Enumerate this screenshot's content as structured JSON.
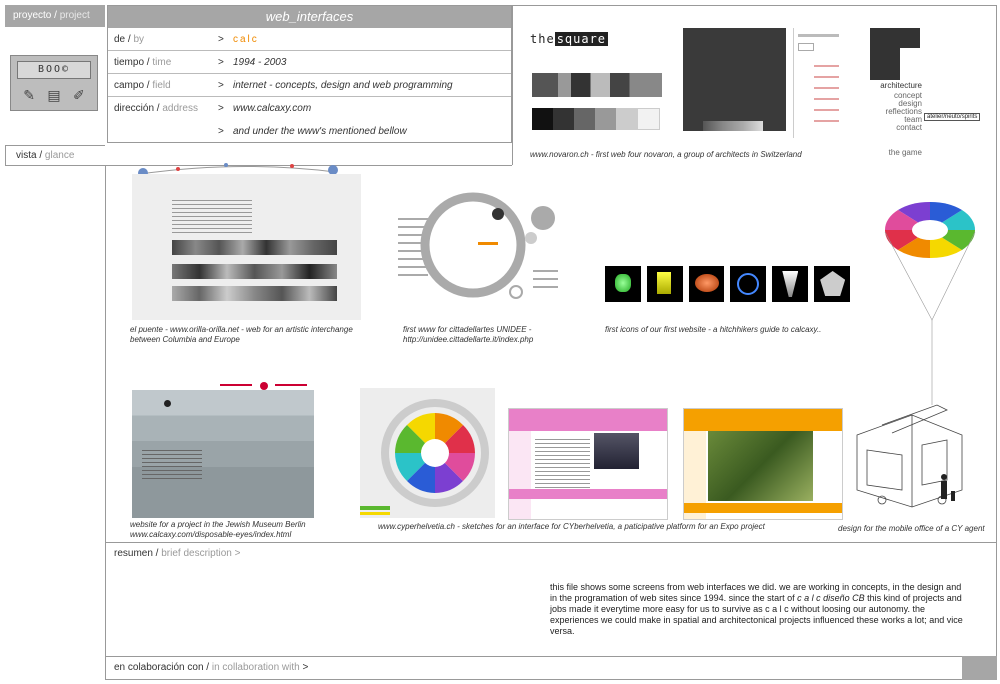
{
  "tab": {
    "es": "proyecto",
    "sep": "/",
    "en": "project"
  },
  "logo": {
    "text": "BOO©",
    "tools": [
      "✎",
      "▤",
      "✐"
    ]
  },
  "info": {
    "title": "web_interfaces",
    "rows": [
      {
        "es": "de",
        "en": "by",
        "arrow": ">",
        "value": "calc"
      },
      {
        "es": "tiempo",
        "en": "time",
        "arrow": ">",
        "value": "1994 - 2003"
      },
      {
        "es": "campo",
        "en": "field",
        "arrow": ">",
        "value": "internet - concepts, design and web programming"
      },
      {
        "es": "dirección",
        "en": "address",
        "arrow": ">",
        "value": "www.calcaxy.com"
      },
      {
        "es": "",
        "en": "",
        "arrow": ">",
        "value": "and under the www's mentioned bellow"
      }
    ]
  },
  "vista": {
    "es": "vista",
    "en": "glance"
  },
  "novaron": {
    "logo_prefix": "the",
    "logo_box": "square",
    "caption": "www.novaron.ch - first web four novaron, a group of architects in Switzerland"
  },
  "architecture": {
    "title": "architecture",
    "links": [
      "concept",
      "design",
      "reflections",
      "team",
      "contact"
    ],
    "tag": "atelier/neuto/spirits",
    "game": "the game"
  },
  "captions": {
    "puente": "el puente - www.orilla-orilla.net - web for an artistic interchange between Columbia and Europe",
    "unidee": "first www for cittadellartes UNIDEE - http://unidee.cittadellarte.it/index.php",
    "icons": "first icons of our first website - a hitchhikers guide to calcaxy..",
    "museum": "website for a project in the Jewish Museum Berlin www.calcaxy.com/disposable-eyes/index.html",
    "cyber": "www.cyperhelvetia.ch - sketches for an interface for CYberhelvetia, a paticipative platform for an Expo project",
    "mobile": "design for the mobile office of a CY agent"
  },
  "resumen": {
    "es": "resumen",
    "en": "brief description",
    "arrow": ">"
  },
  "summary": {
    "part1": "this file shows some screens from web interfaces we did. we are working in concepts, in the design and in the programation of web sites since 1994. since the start of ",
    "emph": "c a l c diseño CB",
    "part2": " this kind of projects and jobs made it everytime more easy for us to survive as c a l c without loosing our autonomy. the experiences we could make in spatial and architectonical projects influenced these works a lot; and vice versa."
  },
  "collab": {
    "es": "en colaboración con",
    "en": "in collaboration with",
    "arrow": ">"
  },
  "colors": {
    "grey_bar": "#a6a6a6",
    "orange": "#f08a00",
    "pink": "#e880c8"
  }
}
